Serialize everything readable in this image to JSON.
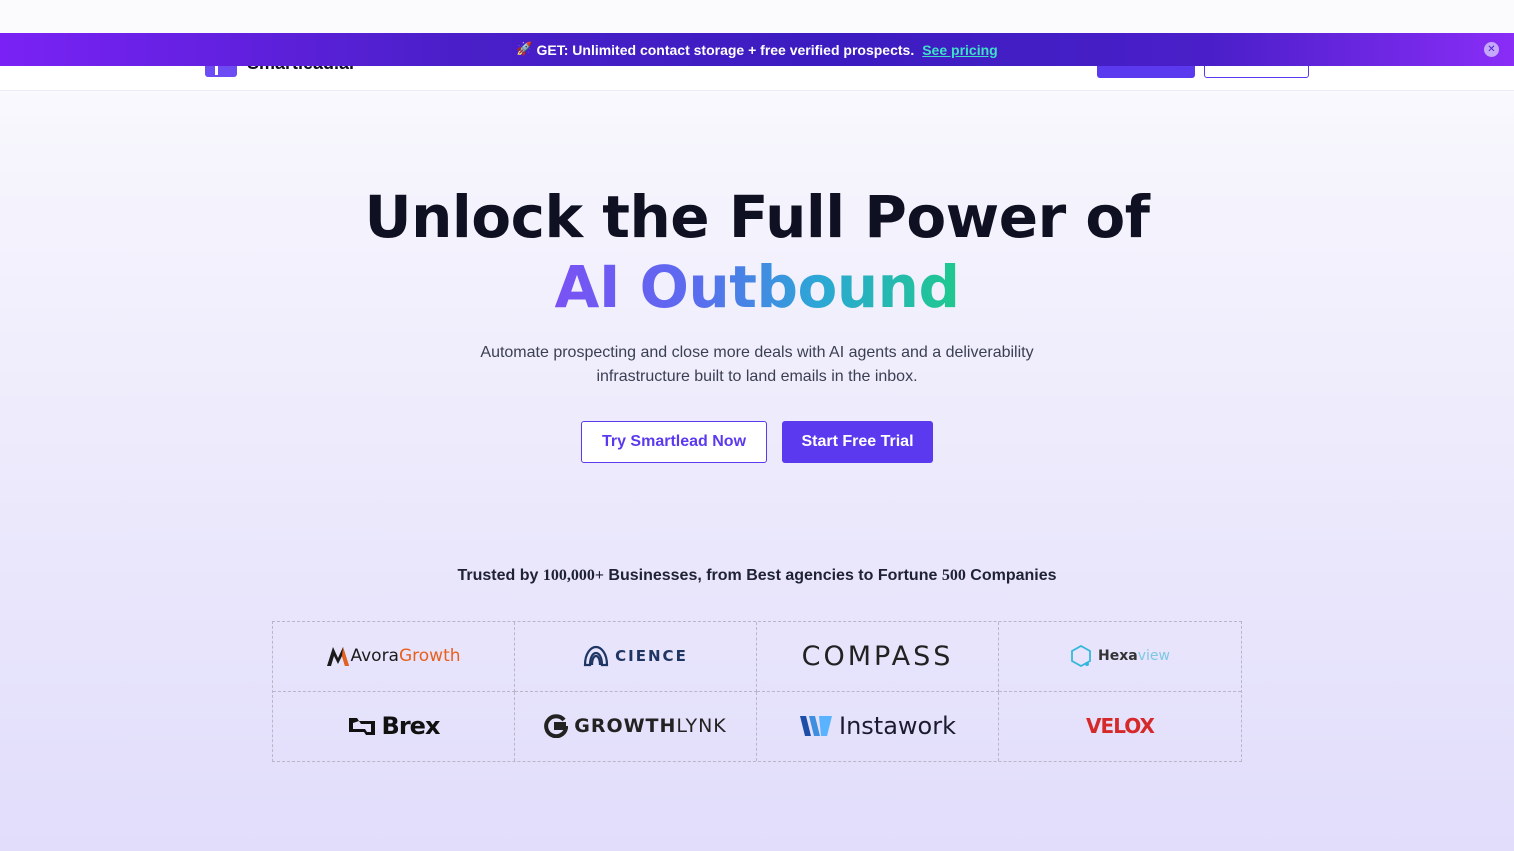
{
  "promo_banner": {
    "icon": "rocket-icon",
    "text": "GET: Unlimited contact storage + free verified prospects.",
    "link_label": "See pricing",
    "close_icon": "close-icon",
    "link_color": "#3ee0c8"
  },
  "navbar": {
    "brand": "Smartlead.ai"
  },
  "hero": {
    "title_line1": "Unlock the Full Power of",
    "title_line2": "AI Outbound",
    "subtitle": "Automate prospecting and close more deals with AI agents and a deliverability infrastructure built to land emails in the inbox.",
    "secondary_cta": "Try Smartlead Now",
    "primary_cta": "Start Free Trial",
    "accent_color": "#5b39ef"
  },
  "trusted": {
    "prefix": "Trusted by ",
    "count": "100,000+",
    "middle": " Businesses, from Best agencies to Fortune ",
    "fortune": "500",
    "suffix": " Companies"
  },
  "logos": {
    "avora": {
      "part1": "Avora",
      "part2": "Growth"
    },
    "cience": "CIENCE",
    "compass": "COMPASS",
    "hexaview": {
      "part1": "Hexa",
      "part2": "view"
    },
    "brex": "Brex",
    "growthlynk": {
      "part1": "GROWTH",
      "part2": "LYNK"
    },
    "instawork": "Instawork",
    "velox": "VELOX"
  }
}
